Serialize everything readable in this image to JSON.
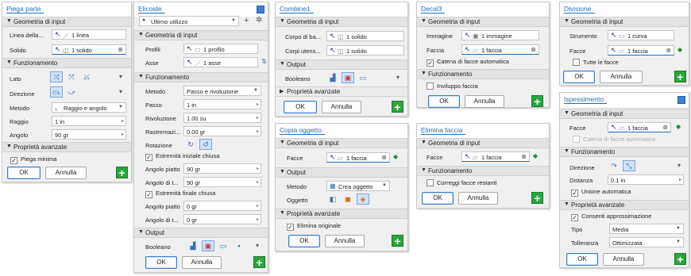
{
  "p1": {
    "title": "Piega parte",
    "s1": "Geometria di input",
    "linea_label": "Linea della...",
    "linea_value": "1 linea",
    "solido_label": "Solido",
    "solido_value": "1 solido",
    "s2": "Funzionamento",
    "lato_label": "Lato",
    "direzione_label": "Direzione",
    "metodo_label": "Metodo",
    "metodo_value": "Raggio e angolo",
    "raggio_label": "Raggio",
    "raggio_value": "1 in",
    "angolo_label": "Angolo",
    "angolo_value": "90 gr",
    "s3": "Proprietà avanzate",
    "piega_minima": "Piega minima",
    "ok": "OK",
    "annulla": "Annulla"
  },
  "p2": {
    "title": "Elicoide",
    "recent": "Ultimo utilizzo",
    "s1": "Geometria di input",
    "profili_label": "Profili",
    "profili_value": "1 profilo",
    "asse_label": "Asse",
    "asse_value": "1 asse",
    "s2": "Funzionamento",
    "metodo_label": "Metodo",
    "metodo_value": "Passo e rivoluzione",
    "passo_label": "Passo",
    "passo_value": "1 in",
    "rivoluzione_label": "Rivoluzione",
    "rivoluzione_value": "1.00 su",
    "rastremazione_label": "Rastremazi...",
    "rastremazione_value": "0.00 gr",
    "rotazione_label": "Rotazione",
    "estremita_iniziale": "Estremità iniziale chiusa",
    "angolo_piatto1_label": "Angolo piatto",
    "angolo_piatto1_value": "90 gr",
    "angolo_t1_label": "Angolo di t...",
    "angolo_t1_value": "90 gr",
    "estremita_finale": "Estremità finale chiusa",
    "angolo_piatto2_label": "Angolo piatto",
    "angolo_piatto2_value": "0 gr",
    "angolo_t2_label": "Angolo di t...",
    "angolo_t2_value": "0 gr",
    "s3": "Output",
    "booleano_label": "Booleano",
    "ok": "OK",
    "annulla": "Annulla"
  },
  "p3": {
    "title": "Combine1",
    "s1": "Geometria di input",
    "corpo_label": "Corpo di ba...",
    "corpo_value": "1 solido",
    "corpi_label": "Corpi utens...",
    "corpi_value": "1 solido",
    "s2": "Output",
    "booleano_label": "Booleano",
    "s3": "Proprietà avanzate",
    "ok": "OK",
    "annulla": "Annulla"
  },
  "p4": {
    "title": "Copia oggetto",
    "s1": "Geometria di input",
    "facce_label": "Facce",
    "facce_value": "1 faccia",
    "s2": "Output",
    "metodo_label": "Metodo",
    "metodo_value": "Crea oggetto",
    "oggetto_label": "Oggetto",
    "s3": "Proprietà avanzate",
    "elimina_originale": "Elimina originale",
    "ok": "OK",
    "annulla": "Annulla"
  },
  "p5": {
    "title": "Decal3",
    "s1": "Geometria di input",
    "immagine_label": "Immagine",
    "immagine_value": "1 immagine",
    "faccia_label": "Faccia",
    "faccia_value": "1 faccia",
    "catena": "Catena di facce automatica",
    "s2": "Funzionamento",
    "inviluppo": "Inviluppo faccia",
    "ok": "OK",
    "annulla": "Annulla"
  },
  "p6": {
    "title": "Elimina faccia",
    "s1": "Geometria di input",
    "facce_label": "Facce",
    "facce_value": "1 faccia",
    "s2": "Funzionamento",
    "correggi": "Correggi facce restanti",
    "ok": "OK",
    "annulla": "Annulla"
  },
  "p7": {
    "title": "Divisione",
    "s1": "Geometria di input",
    "strumento_label": "Strumento",
    "strumento_value": "1 curva",
    "facce_label": "Facce",
    "facce_value": "1 faccia",
    "tutte": "Tutte le facce",
    "ok": "OK",
    "annulla": "Annulla"
  },
  "p8": {
    "title": "Ispessimento",
    "s1": "Geometria di input",
    "facce_label": "Facce",
    "facce_value": "1 faccia",
    "catena": "Catena di facce automatica",
    "s2": "Funzionamento",
    "direzione_label": "Direzione",
    "distanza_label": "Distanza",
    "distanza_value": "0.1 in",
    "unione": "Unione automatica",
    "s3": "Proprietà avanzate",
    "consenti": "Consenti approssimazione",
    "tipo_label": "Tipo",
    "tipo_value": "Media",
    "tolleranza_label": "Tolleranza",
    "tolleranza_value": "Ottimizzata",
    "ok": "OK",
    "annulla": "Annulla"
  },
  "colors": {
    "accent": "#1b6fc0",
    "add": "#2aa53a"
  }
}
